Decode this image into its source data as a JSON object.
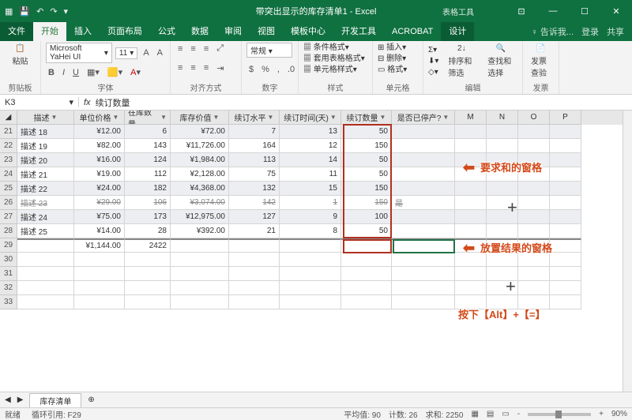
{
  "title": "带突出显示的库存清单1 - Excel",
  "context_tab": "表格工具",
  "file_tab": "文件",
  "tabs": [
    "开始",
    "插入",
    "页面布局",
    "公式",
    "数据",
    "审阅",
    "视图",
    "模板中心",
    "开发工具",
    "ACROBAT",
    "设计"
  ],
  "tell_me": "告诉我...",
  "signin": "登录",
  "share": "共享",
  "font": {
    "name": "Microsoft YaHei UI",
    "size": "11"
  },
  "groups": {
    "clipboard": "剪贴板",
    "font": "字体",
    "align": "对齐方式",
    "number": "数字",
    "styles": "样式",
    "cells": "单元格",
    "editing": "编辑",
    "invoice": "发票"
  },
  "btns": {
    "paste": "粘贴",
    "cond": "条件格式",
    "tblfmt": "套用表格格式",
    "cellstyle": "单元格样式",
    "insert": "插入",
    "delete": "删除",
    "format": "格式",
    "sort": "排序和筛选",
    "find": "查找和选择",
    "invoice": "发票查验"
  },
  "namebox": "K3",
  "formula": "续订数量",
  "headers": [
    "描述",
    "单位价格",
    "在库数量",
    "库存价值",
    "续订水平",
    "续订时间(天)",
    "续订数量",
    "是否已停产?"
  ],
  "extra_cols": [
    "M",
    "N",
    "O",
    "P"
  ],
  "rows": [
    {
      "n": 21,
      "d": "描述 18",
      "p": "¥12.00",
      "q": "6",
      "v": "¥72.00",
      "r": "7",
      "t": "13",
      "o": "50",
      "s": ""
    },
    {
      "n": 22,
      "d": "描述 19",
      "p": "¥82.00",
      "q": "143",
      "v": "¥11,726.00",
      "r": "164",
      "t": "12",
      "o": "150",
      "s": ""
    },
    {
      "n": 23,
      "d": "描述 20",
      "p": "¥16.00",
      "q": "124",
      "v": "¥1,984.00",
      "r": "113",
      "t": "14",
      "o": "50",
      "s": ""
    },
    {
      "n": 24,
      "d": "描述 21",
      "p": "¥19.00",
      "q": "112",
      "v": "¥2,128.00",
      "r": "75",
      "t": "11",
      "o": "50",
      "s": ""
    },
    {
      "n": 25,
      "d": "描述 22",
      "p": "¥24.00",
      "q": "182",
      "v": "¥4,368.00",
      "r": "132",
      "t": "15",
      "o": "150",
      "s": ""
    },
    {
      "n": 26,
      "d": "描述 23",
      "p": "¥29.00",
      "q": "106",
      "v": "¥3,074.00",
      "r": "142",
      "t": "1",
      "o": "150",
      "s": "是",
      "strike": true
    },
    {
      "n": 27,
      "d": "描述 24",
      "p": "¥75.00",
      "q": "173",
      "v": "¥12,975.00",
      "r": "127",
      "t": "9",
      "o": "100",
      "s": ""
    },
    {
      "n": 28,
      "d": "描述 25",
      "p": "¥14.00",
      "q": "28",
      "v": "¥392.00",
      "r": "21",
      "t": "8",
      "o": "50",
      "s": ""
    }
  ],
  "total": {
    "n": 29,
    "p": "¥1,144.00",
    "q": "2422"
  },
  "empty_rows": [
    30,
    31,
    32,
    33
  ],
  "sheet_tab": "库存清单",
  "status": {
    "ready": "就绪",
    "circ": "循环引用: F29",
    "avg": "平均值: 90",
    "count": "计数: 26",
    "sum": "求和: 2250",
    "zoom": "90%"
  },
  "annotations": {
    "a1": "要求和的窗格",
    "a2": "放置结果的窗格",
    "a3": "按下【Alt】+【=】"
  }
}
